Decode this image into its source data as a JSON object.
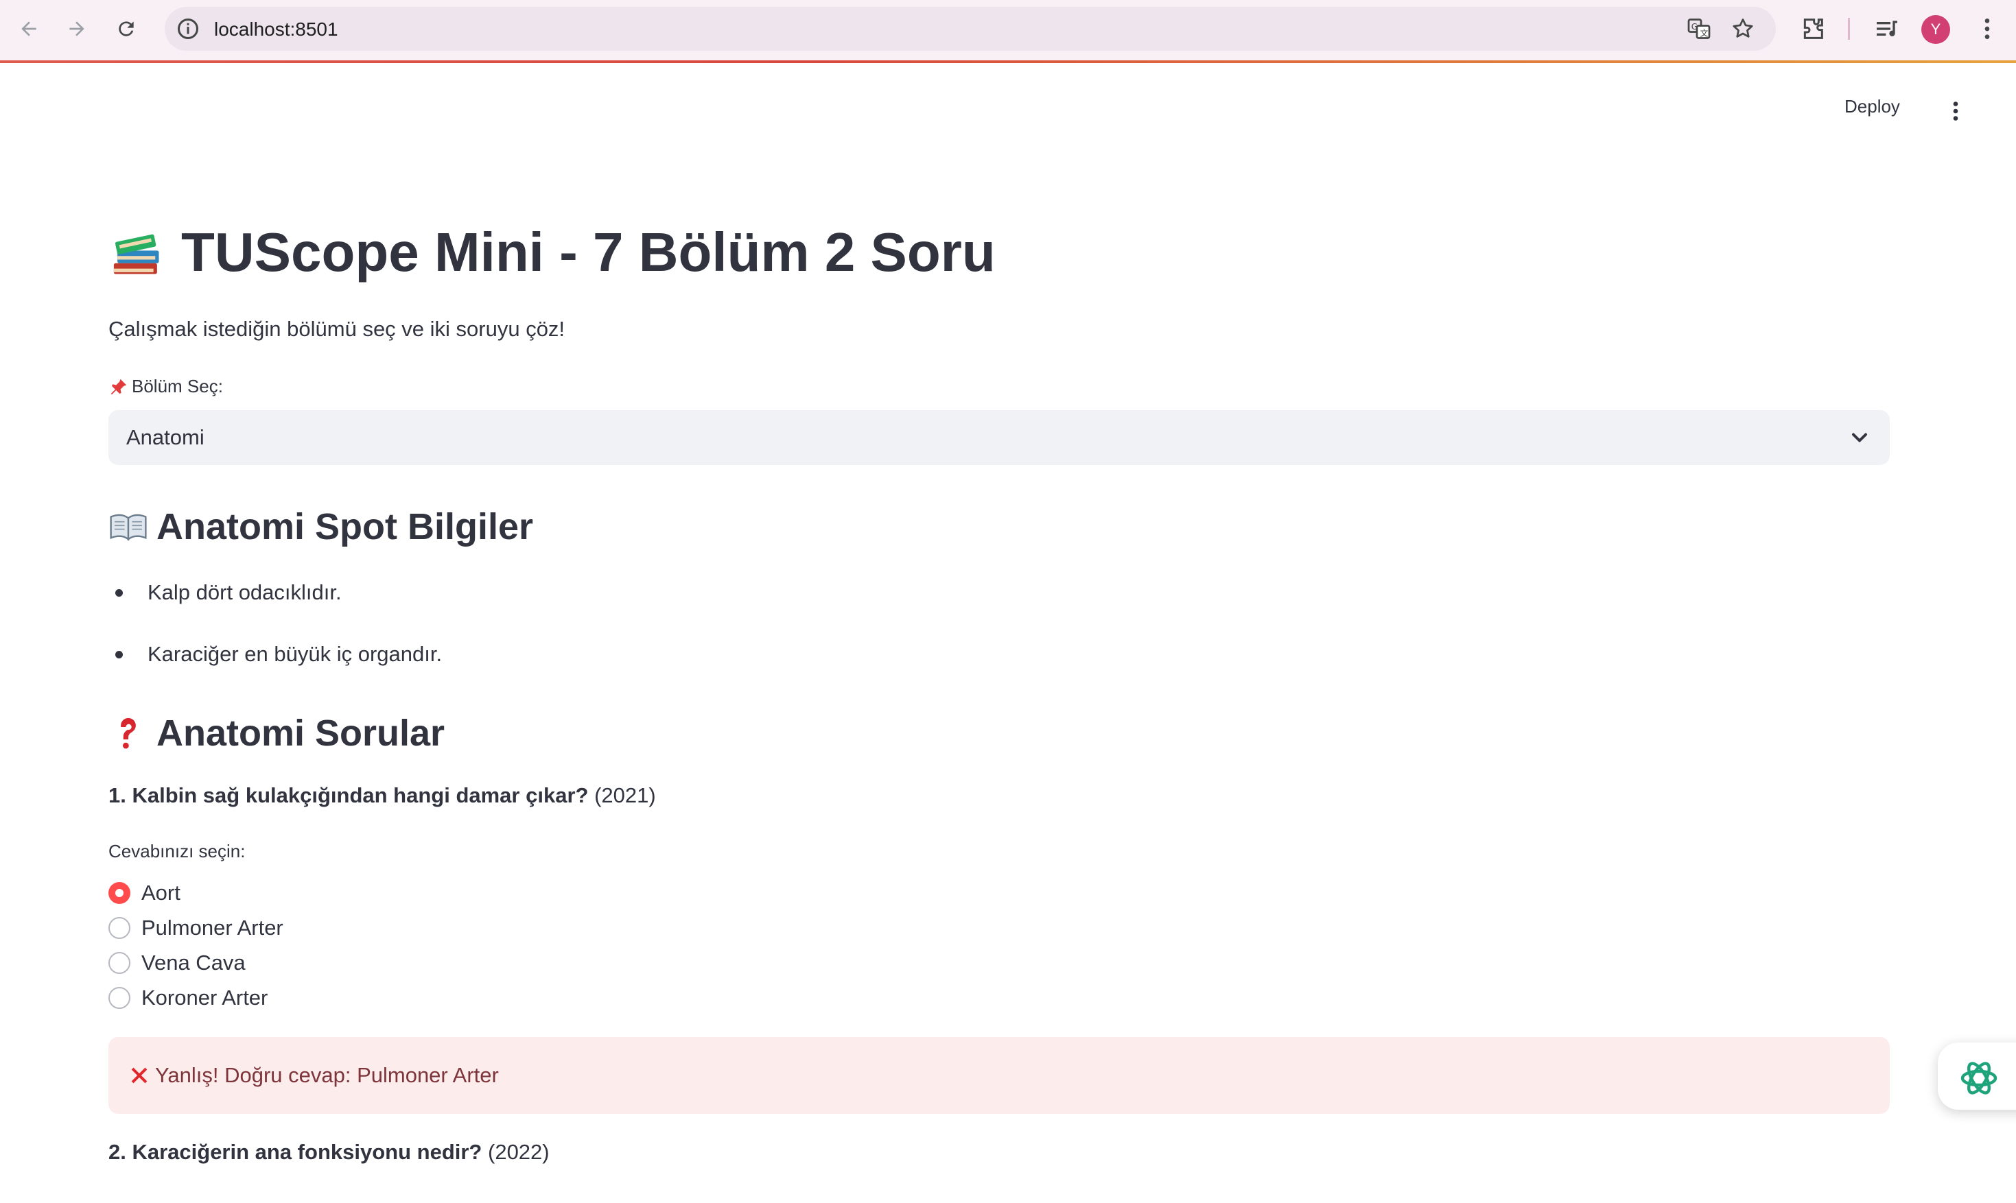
{
  "browser": {
    "url": "localhost:8501",
    "avatar_letter": "Y",
    "icons": [
      "back-arrow-icon",
      "forward-arrow-icon",
      "reload-icon",
      "site-info-icon",
      "translate-icon",
      "bookmark-star-icon",
      "extensions-icon",
      "media-control-icon",
      "chrome-menu-icon"
    ]
  },
  "app_header": {
    "deploy_label": "Deploy",
    "menu_icon": "kebab-menu-icon"
  },
  "page": {
    "title": "TUScope Mini - 7 Bölüm 2 Soru",
    "title_icon": "books-emoji-icon",
    "subtitle": "Çalışmak istediğin bölümü seç ve iki soruyu çöz!",
    "section_select": {
      "label": "Bölüm Seç:",
      "label_icon": "pushpin-emoji-icon",
      "selected": "Anatomi"
    },
    "spot": {
      "heading": "Anatomi Spot Bilgiler",
      "icon": "open-book-emoji-icon",
      "items": [
        "Kalp dört odacıklıdır.",
        "Karaciğer en büyük iç organdır."
      ]
    },
    "questions_section": {
      "heading": "Anatomi Sorular",
      "icon": "question-mark-emoji-icon"
    },
    "questions": [
      {
        "text": "1. Kalbin sağ kulakçığından hangi damar çıkar?",
        "year": "(2021)",
        "answer_label": "Cevabınızı seçin:",
        "options": [
          "Aort",
          "Pulmoner Arter",
          "Vena Cava",
          "Koroner Arter"
        ],
        "selected_index": 0,
        "feedback": "Yanlış! Doğru cevap: Pulmoner Arter"
      },
      {
        "text": "2. Karaciğerin ana fonksiyonu nedir?",
        "year": "(2022)"
      }
    ]
  },
  "colors": {
    "accent": "#ff4b4b",
    "error_bg": "#fdecec",
    "error_text": "#7d353b",
    "text": "#31333f"
  }
}
